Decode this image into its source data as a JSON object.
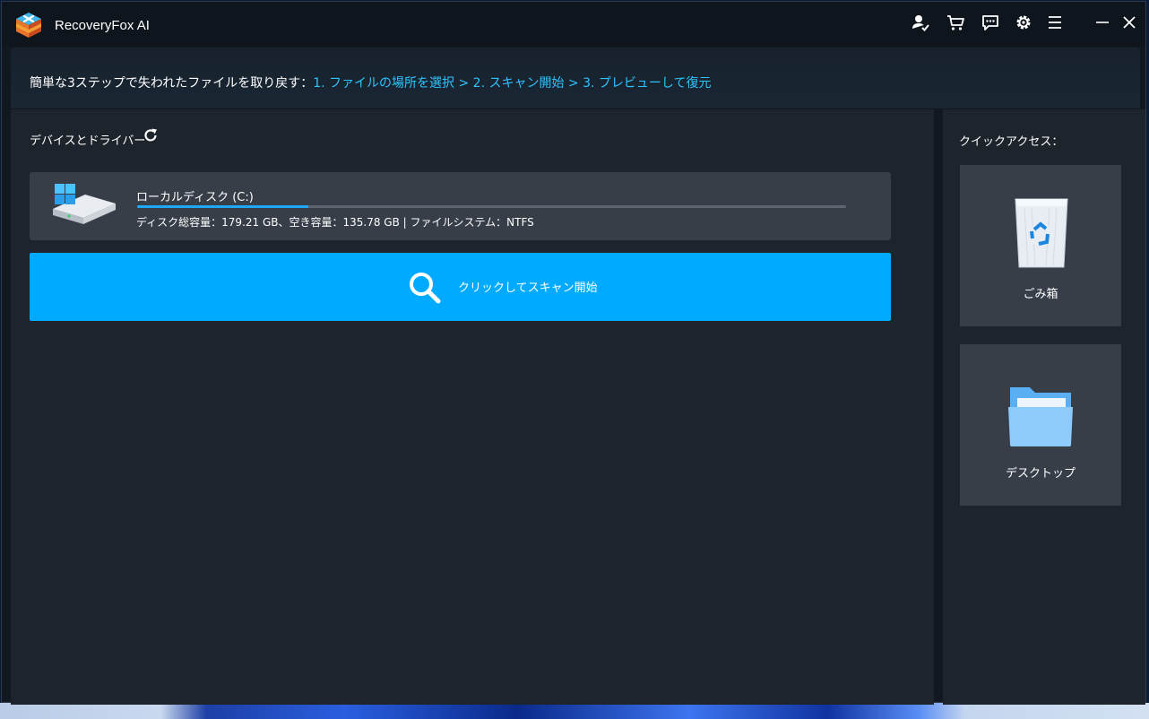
{
  "app": {
    "title": "RecoveryFox AI"
  },
  "toolbar": {
    "icons": [
      "account-icon",
      "cart-icon",
      "feedback-icon",
      "settings-icon",
      "menu-icon",
      "minimize-icon",
      "close-icon"
    ]
  },
  "banner": {
    "lead": "簡単な3ステップで失われたファイルを取り戻す：",
    "steps": "1. ファイルの場所を選択 > 2. スキャン開始 > 3. プレビューして復元"
  },
  "devices": {
    "title": "デバイスとドライバー",
    "drive": {
      "name": "ローカルディスク (C:)",
      "info": "ディスク総容量：179.21 GB、空き容量：135.78 GB | ファイルシステム：NTFS",
      "used_fraction": 0.242
    }
  },
  "scan": {
    "label": "クリックしてスキャン開始"
  },
  "quick_access": {
    "title": "クイックアクセス：",
    "items": [
      {
        "label": "ごみ箱",
        "icon": "recycle-bin-icon"
      },
      {
        "label": "デスクトップ",
        "icon": "folder-icon"
      }
    ]
  },
  "colors": {
    "accent": "#00aaff",
    "steps_text": "#2ec4ff",
    "panel": "#1e242c",
    "card": "#373e48"
  }
}
